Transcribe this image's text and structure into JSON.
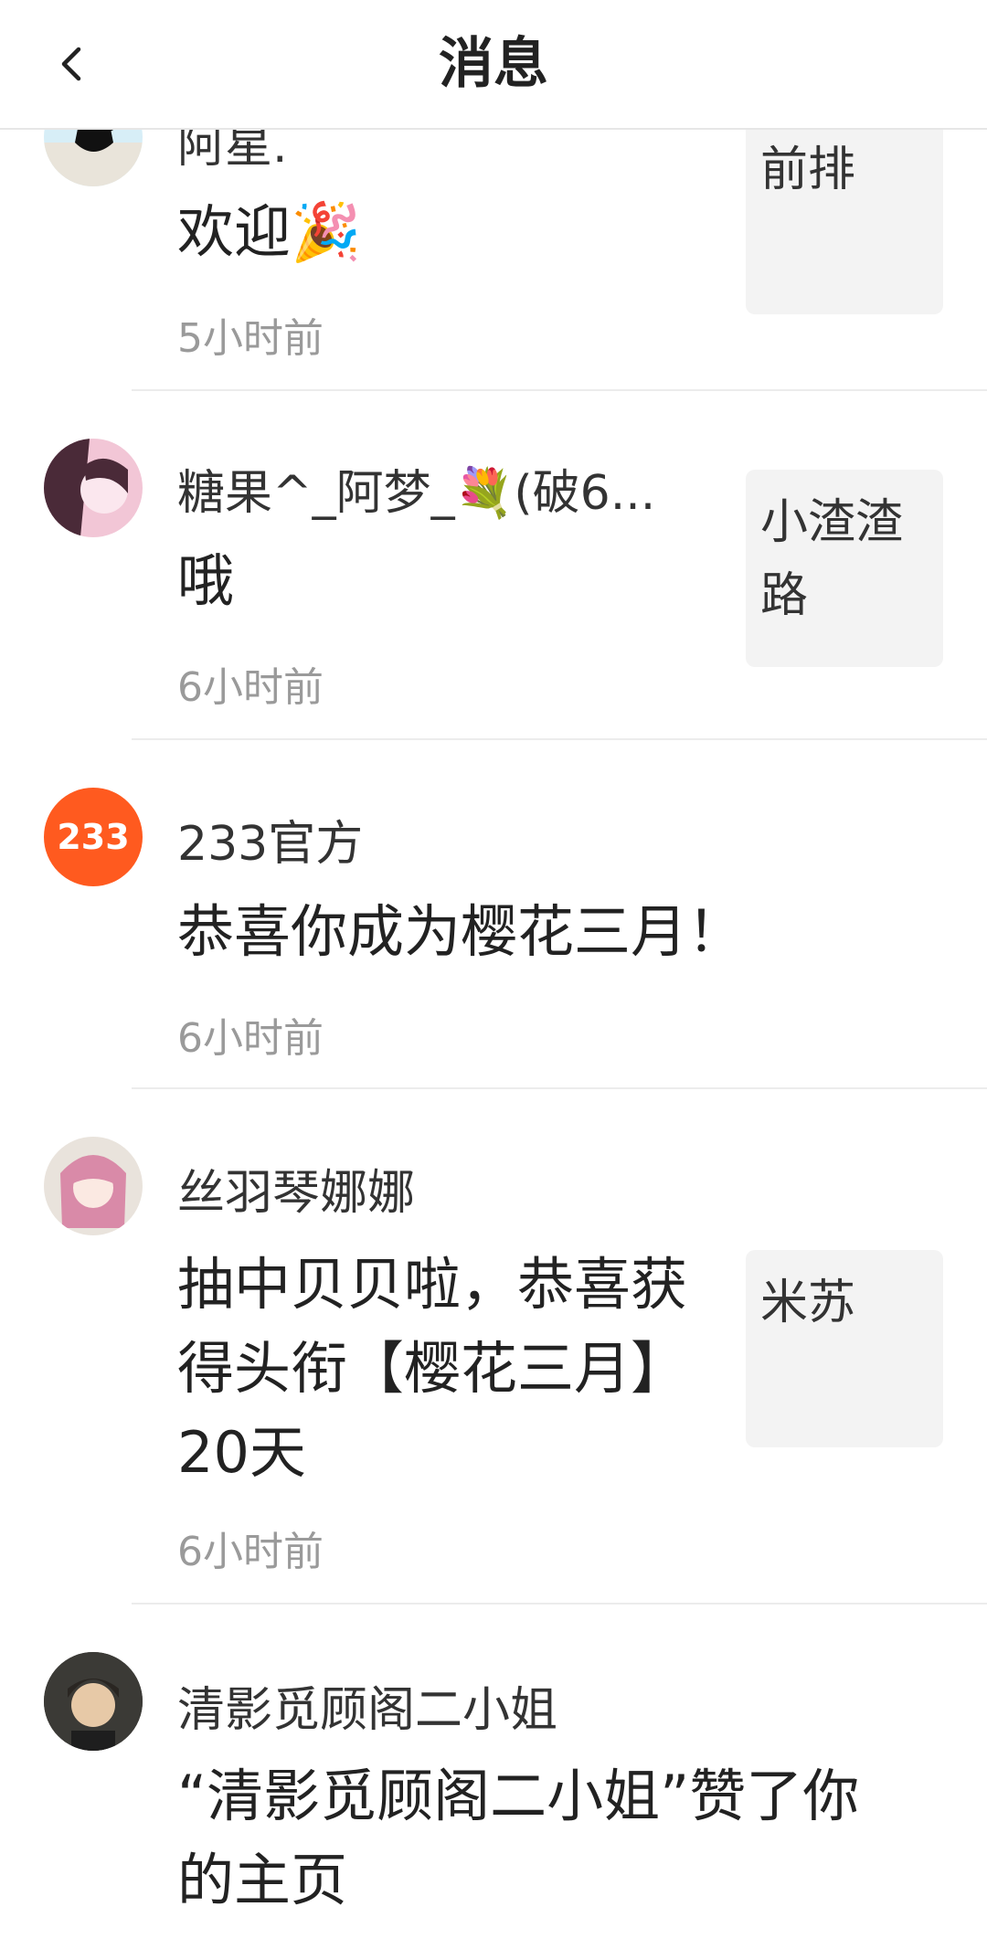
{
  "header": {
    "title": "消息",
    "back_icon": "chevron-left-icon"
  },
  "messages": [
    {
      "name": "阿星.",
      "text": "欢迎🎉",
      "time": "5小时前",
      "thumb": "前排",
      "avatar_colors": [
        "#d7eef7",
        "#111111"
      ]
    },
    {
      "name": "糖果^_阿梦_💐(破6...",
      "text": "哦",
      "time": "6小时前",
      "thumb": "小渣渣路",
      "avatar_colors": [
        "#f2c6d6",
        "#4a2a38"
      ]
    },
    {
      "name": "233官方",
      "text": "恭喜你成为樱花三月！",
      "time": "6小时前",
      "thumb": "",
      "avatar_label": "233",
      "avatar_colors": [
        "#ff5a1f",
        "#ffffff"
      ]
    },
    {
      "name": "丝羽琴娜娜",
      "text": "抽中贝贝啦，恭喜获得头衔【樱花三月】20天",
      "time": "6小时前",
      "thumb": "米苏",
      "avatar_colors": [
        "#e9e3dc",
        "#d98aa8"
      ]
    },
    {
      "name": "清影觅顾阁二小姐",
      "text": "“清影觅顾阁二小姐”赞了你的主页",
      "time": "",
      "thumb": "",
      "avatar_colors": [
        "#3b3a36",
        "#e7c9a7"
      ]
    }
  ]
}
